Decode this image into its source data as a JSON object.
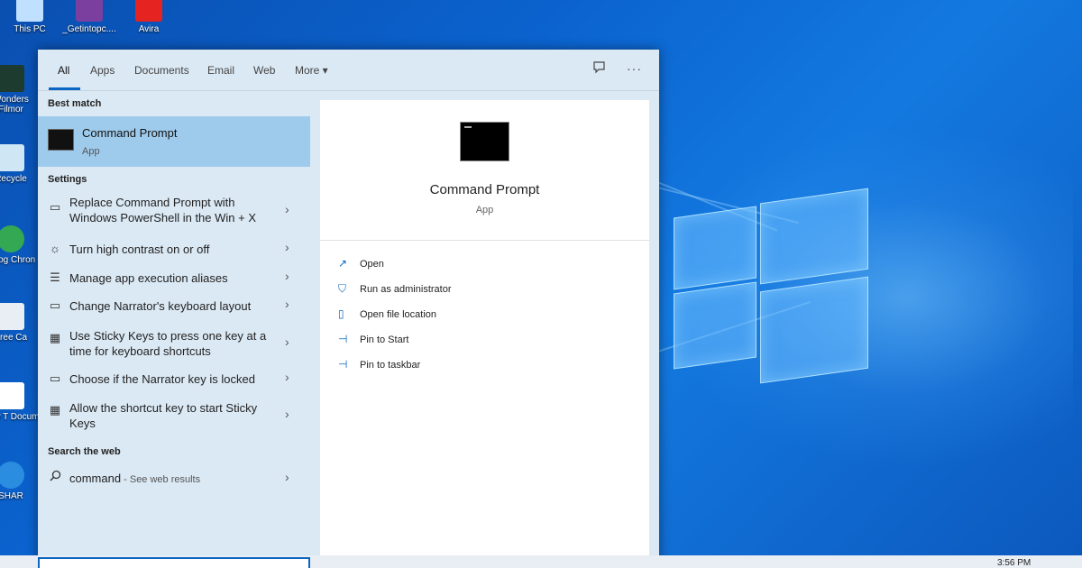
{
  "desktop": {
    "icons": [
      {
        "label": "This PC"
      },
      {
        "label": "_Getintopc...."
      },
      {
        "label": "Avira"
      },
      {
        "label": "Wonders Filmor"
      },
      {
        "label": "Recycle"
      },
      {
        "label": "Goog Chron"
      },
      {
        "label": "Free Ca"
      },
      {
        "label": "New T Docum"
      },
      {
        "label": "SHAR"
      }
    ]
  },
  "search": {
    "tabs": [
      {
        "label": "All"
      },
      {
        "label": "Apps"
      },
      {
        "label": "Documents"
      },
      {
        "label": "Email"
      },
      {
        "label": "Web"
      },
      {
        "label": "More ▾"
      }
    ],
    "feedback_icon": "feedback-icon",
    "more_options": "···",
    "best_match_heading": "Best match",
    "best_match": {
      "title": "Command Prompt",
      "subtitle": "App"
    },
    "settings_heading": "Settings",
    "settings": [
      {
        "icon": "▭",
        "text": "Replace Command Prompt with Windows PowerShell in the Win + X"
      },
      {
        "icon": "☼",
        "text": "Turn high contrast on or off"
      },
      {
        "icon": "☰",
        "text": "Manage app execution aliases"
      },
      {
        "icon": "▭",
        "text": "Change Narrator's keyboard layout"
      },
      {
        "icon": "▦",
        "text": "Use Sticky Keys to press one key at a time for keyboard shortcuts"
      },
      {
        "icon": "▭",
        "text": "Choose if the Narrator key is locked"
      },
      {
        "icon": "▦",
        "text": "Allow the shortcut key to start Sticky Keys"
      }
    ],
    "web_heading": "Search the web",
    "web_result": {
      "query": "command",
      "suffix": " - See web results"
    },
    "preview": {
      "title": "Command Prompt",
      "subtitle": "App",
      "actions": [
        {
          "icon": "↗",
          "label": "Open"
        },
        {
          "icon": "⛉",
          "label": "Run as administrator"
        },
        {
          "icon": "▯",
          "label": "Open file location"
        },
        {
          "icon": "⊣",
          "label": "Pin to Start"
        },
        {
          "icon": "⊣",
          "label": "Pin to taskbar"
        }
      ]
    }
  },
  "taskbar": {
    "clock": "3:56 PM"
  },
  "colors": {
    "accent": "#0a66c2",
    "selected": "#9ecbec",
    "panel": "#dbe9f4"
  }
}
